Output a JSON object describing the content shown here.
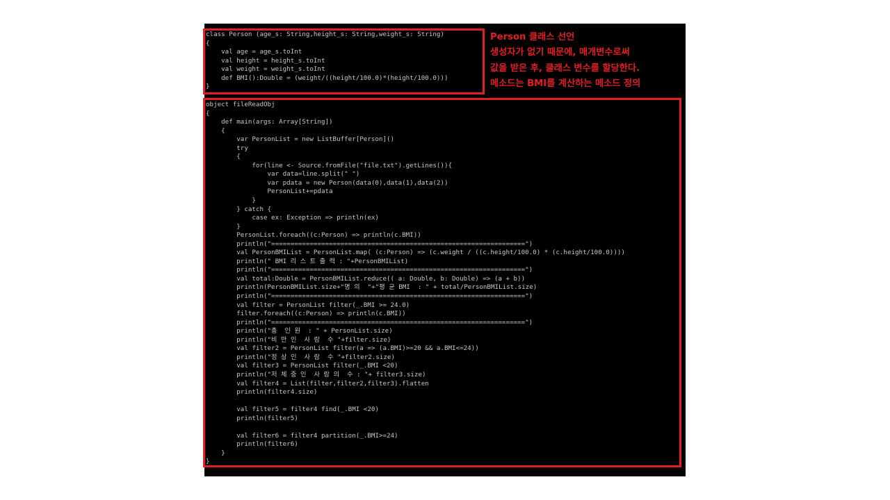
{
  "colors": {
    "terminal_background": "#000000",
    "code_text": "#c8c8c8",
    "highlight_box": "#e31e24",
    "annotation_text": "#e31e24"
  },
  "annotation": {
    "lines": [
      "Person 클래스 선언",
      "생성자가 없기 때문에, 매개변수로써",
      "값을 받은 후, 클래스 변수를 할당한다.",
      "메소드는 BMI를 계산하는 메소드 정의"
    ]
  },
  "code": {
    "class_block": [
      "class Person (age_s: String,height_s: String,weight_s: String)",
      "{",
      "    val age = age_s.toInt",
      "    val height = height_s.toInt",
      "    val weight = weight_s.toInt",
      "    def BMI():Double = (weight/((height/100.0)*(height/100.0)))",
      "}"
    ],
    "object_block": [
      "object fileReadObj",
      "{",
      "    def main(args: Array[String])",
      "    {",
      "        var PersonList = new ListBuffer[Person]()",
      "        try",
      "        {",
      "            for(line <- Source.fromFile(\"file.txt\").getLines()){",
      "                var data=line.split(\" \")",
      "                var pdata = new Person(data(0),data(1),data(2))",
      "                PersonList+=pdata",
      "            }",
      "        } catch {",
      "            case ex: Exception => println(ex)",
      "        }",
      "        PersonList.foreach((c:Person) => println(c.BMI))",
      "        println(\"==================================================================\")",
      "        val PersonBMIList = PersonList.map( (c:Person) => (c.weight / ((c.height/100.0) * (c.height/100.0))))",
      "        println(\" BMI 리 스 트 출 력 : \"+PersonBMIList)",
      "        println(\"==================================================================\")",
      "        val total:Double = PersonBMIList.reduce(( a: Double, b: Double) => (a + b))",
      "        println(PersonBMIList.size+\"명 의  \"+\"평 균 BMI  : \" + total/PersonBMIList.size)",
      "        println(\"==================================================================\")",
      "        val filter = PersonList filter(_.BMI >= 24.0)",
      "        filter.foreach((c:Person) => println(c.BMI))",
      "        println(\"==================================================================\")",
      "        println(\"총  인 원  : \" + PersonList.size)",
      "        println(\"비 만 인  사 람  수 \"+filter.size)",
      "        val filter2 = PersonList filter(a => (a.BMI)>=20 && a.BMI<=24))",
      "        println(\"정 상 인  사 람  수 \"+filter2.size)",
      "        val filter3 = PersonList filter(_.BMI <20)",
      "        println(\"저 체 중 인  사 람 의  수 : \"+ filter3.size)",
      "        val filter4 = List(filter,filter2,filter3).flatten",
      "        println(filter4.size)",
      "",
      "        val filter5 = filter4 find(_.BMI <20)",
      "        println(filter5)",
      "",
      "        val filter6 = filter4 partition(_.BMI>=24)",
      "        println(filter6)",
      "    }",
      "}"
    ]
  }
}
